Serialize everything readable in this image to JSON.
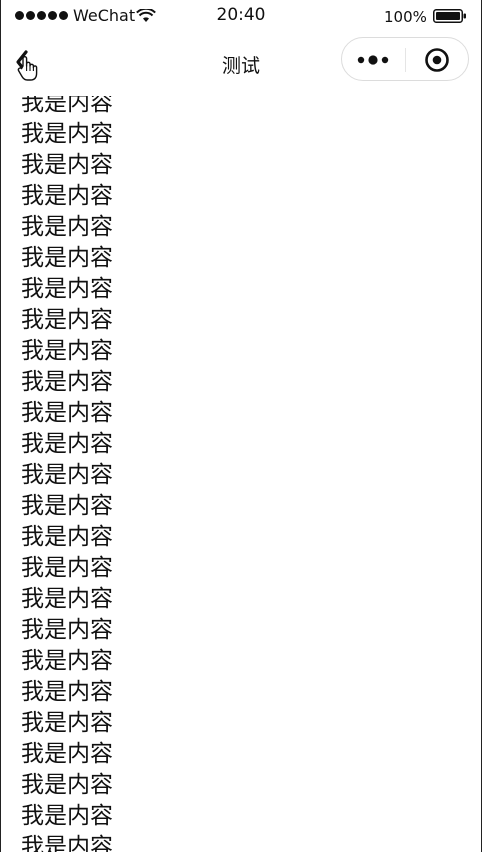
{
  "status_bar": {
    "carrier": "WeChat",
    "time": "20:40",
    "battery_percent": "100%"
  },
  "nav": {
    "title": "测试",
    "icons": {
      "back": "chevron-left-icon",
      "more": "more-dots-icon",
      "close": "target-circle-icon"
    }
  },
  "content": {
    "items": [
      "我是内容",
      "我是内容",
      "我是内容",
      "我是内容",
      "我是内容",
      "我是内容",
      "我是内容",
      "我是内容",
      "我是内容",
      "我是内容",
      "我是内容",
      "我是内容",
      "我是内容",
      "我是内容",
      "我是内容",
      "我是内容",
      "我是内容",
      "我是内容",
      "我是内容",
      "我是内容",
      "我是内容",
      "我是内容",
      "我是内容",
      "我是内容",
      "我是内容"
    ]
  }
}
